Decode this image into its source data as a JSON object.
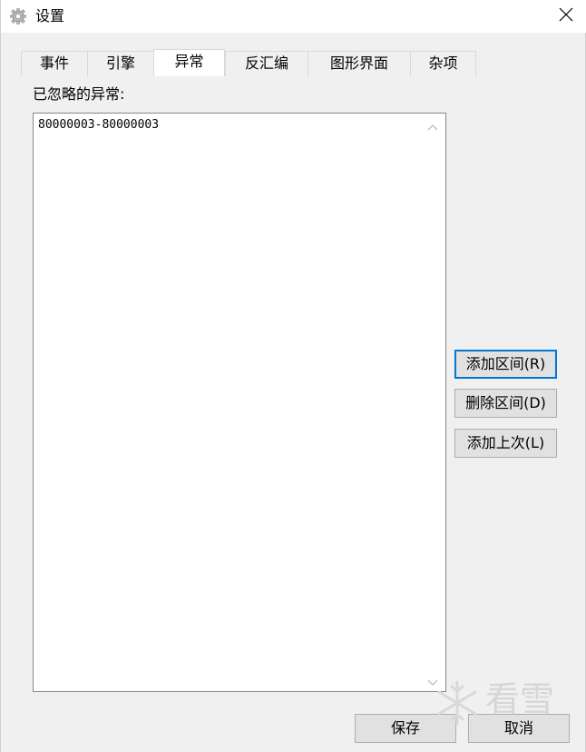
{
  "window": {
    "title": "设置"
  },
  "tabs": [
    {
      "label": "事件",
      "active": false
    },
    {
      "label": "引擎",
      "active": false
    },
    {
      "label": "异常",
      "active": true
    },
    {
      "label": "反汇编",
      "active": false
    },
    {
      "label": "图形界面",
      "active": false
    },
    {
      "label": "杂项",
      "active": false
    }
  ],
  "exceptions": {
    "label": "已忽略的异常:",
    "items": [
      "80000003-80000003"
    ]
  },
  "side_buttons": {
    "add_range": "添加区间(R)",
    "delete_range": "删除区间(D)",
    "add_last": "添加上次(L)"
  },
  "footer": {
    "save": "保存",
    "cancel": "取消"
  },
  "watermark": {
    "text": "看雪"
  },
  "colors": {
    "focus_border": "#0078d7",
    "button_face": "#e1e1e1",
    "window_bg": "#f0f0f0"
  },
  "icons": {
    "title": "gear-icon",
    "close": "close-icon",
    "scroll_up": "chevron-up-icon",
    "scroll_down": "chevron-down-icon",
    "watermark": "snowflake-icon"
  }
}
